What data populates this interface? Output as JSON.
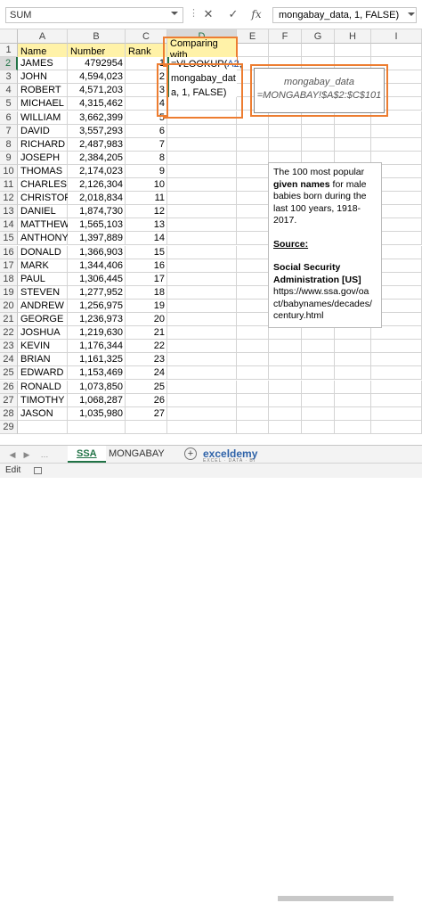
{
  "formula_bar": {
    "name_box": "SUM",
    "cancel": "✕",
    "enter": "✓",
    "fx": "fx",
    "formula": "mongabay_data, 1, FALSE)"
  },
  "columns": [
    "A",
    "B",
    "C",
    "D",
    "E",
    "F",
    "G",
    "H",
    "I"
  ],
  "rows": [
    "1",
    "2",
    "3",
    "4",
    "5",
    "6",
    "7",
    "8",
    "9",
    "10",
    "11",
    "12",
    "13",
    "14",
    "15",
    "16",
    "17",
    "18",
    "19",
    "20",
    "21",
    "22",
    "23",
    "24",
    "25",
    "26",
    "27",
    "28",
    "29"
  ],
  "headers": {
    "name": "Name",
    "number": "Number",
    "rank": "Rank",
    "comparing": "Comparing",
    "with": "with Mongabay"
  },
  "data": [
    {
      "name": "JAMES",
      "number": "4792954",
      "rank": "1"
    },
    {
      "name": "JOHN",
      "number": "4,594,023",
      "rank": "2"
    },
    {
      "name": "ROBERT",
      "number": "4,571,203",
      "rank": "3"
    },
    {
      "name": "MICHAEL",
      "number": "4,315,462",
      "rank": "4"
    },
    {
      "name": "WILLIAM",
      "number": "3,662,399",
      "rank": "5"
    },
    {
      "name": "DAVID",
      "number": "3,557,293",
      "rank": "6"
    },
    {
      "name": "RICHARD",
      "number": "2,487,983",
      "rank": "7"
    },
    {
      "name": "JOSEPH",
      "number": "2,384,205",
      "rank": "8"
    },
    {
      "name": "THOMAS",
      "number": "2,174,023",
      "rank": "9"
    },
    {
      "name": "CHARLES",
      "number": "2,126,304",
      "rank": "10"
    },
    {
      "name": "CHRISTOPHE",
      "number": "2,018,834",
      "rank": "11"
    },
    {
      "name": "DANIEL",
      "number": "1,874,730",
      "rank": "12"
    },
    {
      "name": "MATTHEW",
      "number": "1,565,103",
      "rank": "13"
    },
    {
      "name": "ANTHONY",
      "number": "1,397,889",
      "rank": "14"
    },
    {
      "name": "DONALD",
      "number": "1,366,903",
      "rank": "15"
    },
    {
      "name": "MARK",
      "number": "1,344,406",
      "rank": "16"
    },
    {
      "name": "PAUL",
      "number": "1,306,445",
      "rank": "17"
    },
    {
      "name": "STEVEN",
      "number": "1,277,952",
      "rank": "18"
    },
    {
      "name": "ANDREW",
      "number": "1,256,975",
      "rank": "19"
    },
    {
      "name": "GEORGE",
      "number": "1,236,973",
      "rank": "20"
    },
    {
      "name": "JOSHUA",
      "number": "1,219,630",
      "rank": "21"
    },
    {
      "name": "KEVIN",
      "number": "1,176,344",
      "rank": "22"
    },
    {
      "name": "BRIAN",
      "number": "1,161,325",
      "rank": "23"
    },
    {
      "name": "EDWARD",
      "number": "1,153,469",
      "rank": "24"
    },
    {
      "name": "RONALD",
      "number": "1,073,850",
      "rank": "25"
    },
    {
      "name": "TIMOTHY",
      "number": "1,068,287",
      "rank": "26"
    },
    {
      "name": "JASON",
      "number": "1,035,980",
      "rank": "27"
    }
  ],
  "formula_popup": {
    "line1_pre": "=VLOOKUP(",
    "line1_ref": "A2",
    "line1_post": ",",
    "line2": "mongabay_dat",
    "line3": "a, 1, FALSE)"
  },
  "name_def": {
    "name": "mongabay_data",
    "ref": "=MONGABAY!$A$2:$C$101"
  },
  "note": {
    "line1": "The 100 most popular",
    "line2_b": "given names",
    "line2_rest": " for male",
    "line3": "babies born during the",
    "line4": "last 100 years, 1918-",
    "line5": "2017.",
    "source": "Source:",
    "org1": "Social Security",
    "org2": "Administration [US]",
    "url1": "https://www.ssa.gov/oa",
    "url2": "ct/babynames/decades/",
    "url3": "century.html"
  },
  "tabs": {
    "t1": "SSA",
    "t2": "MONGABAY",
    "add": "+"
  },
  "logo": {
    "name": "exceldemy",
    "tag": "EXCEL · DATA · BI"
  },
  "status": {
    "mode": "Edit"
  },
  "colors": {
    "accent": "#217346",
    "highlight": "#ed7d31",
    "header_fill": "#fff2a8"
  }
}
